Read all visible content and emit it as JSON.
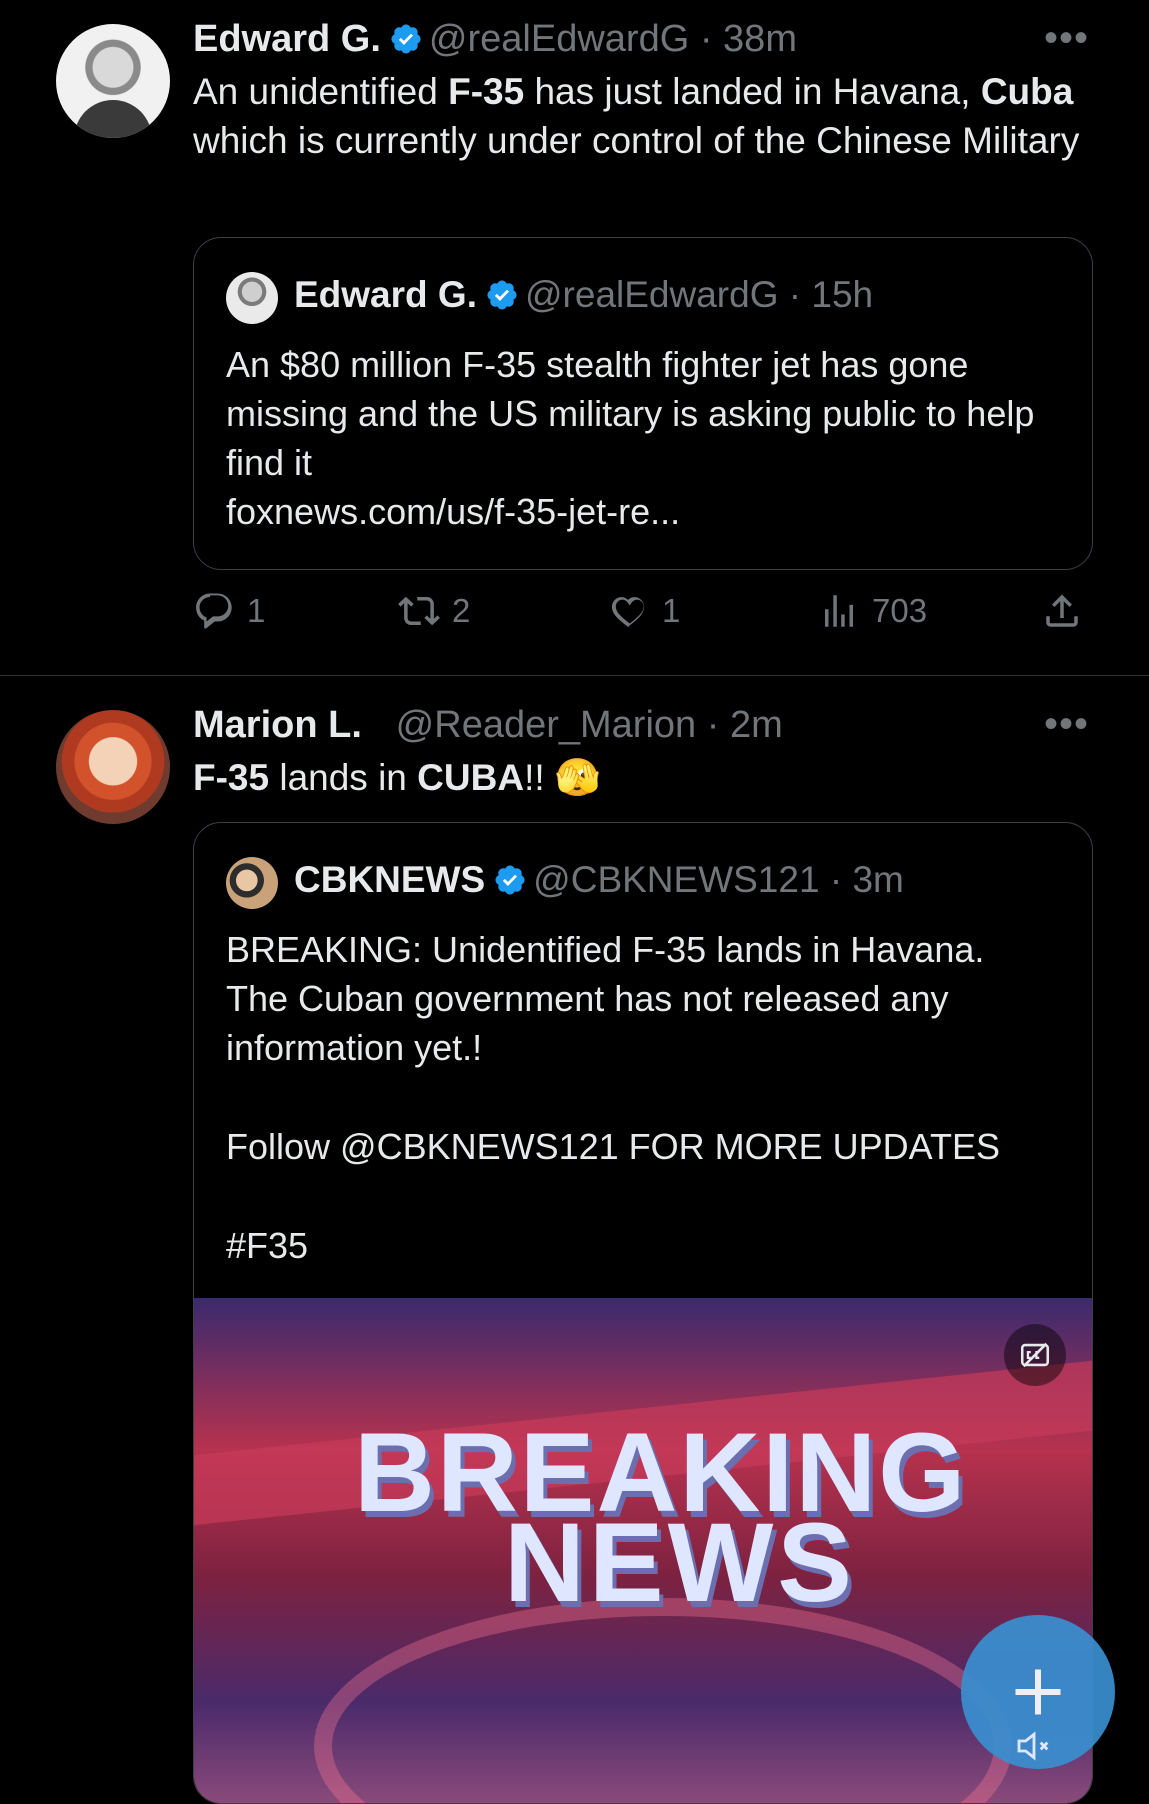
{
  "tweets": [
    {
      "name": "Edward G.",
      "handle": "@realEdwardG",
      "sep": " · ",
      "time": "38m",
      "more": "•••",
      "text_parts": [
        "An unidentified ",
        "F-35",
        " has just landed in Havana, ",
        "Cuba",
        " which is currently under control of the Chinese Military"
      ],
      "quote": {
        "name": "Edward G.",
        "handle": "@realEdwardG",
        "time": "15h",
        "text": "An $80 million F-35 stealth fighter jet has gone missing and the US military is asking public to help find it",
        "link": "foxnews.com/us/f-35-jet-re..."
      },
      "actions": {
        "replies": "1",
        "reposts": "2",
        "likes": "1",
        "views": "703"
      }
    },
    {
      "name": "Marion L.",
      "handle": "@Reader_Marion",
      "time": "2m",
      "more": "•••",
      "text_parts": [
        "F-35",
        " lands in ",
        "CUBA",
        "!! ",
        "🫣"
      ],
      "quote": {
        "name": "CBKNEWS",
        "handle": "@CBKNEWS121",
        "time": "3m",
        "line1": "BREAKING: Unidentified F-35 lands in Havana.",
        "line2": "The Cuban government has not released any",
        "line3": "information yet.!",
        "line4": "Follow @CBKNEWS121 FOR MORE UPDATES",
        "line5": "#F35",
        "media": {
          "word1": "BREAKING",
          "word2": "NEWS"
        }
      }
    }
  ],
  "colors": {
    "accent": "#1d9bf0",
    "muted": "#71767b",
    "text": "#e7e9ea",
    "background": "#000000"
  },
  "icons": [
    "verified-badge-icon",
    "more-icon",
    "reply-icon",
    "repost-icon",
    "like-icon",
    "views-icon",
    "share-icon",
    "captions-off-icon",
    "compose-plus-icon",
    "mute-icon"
  ]
}
